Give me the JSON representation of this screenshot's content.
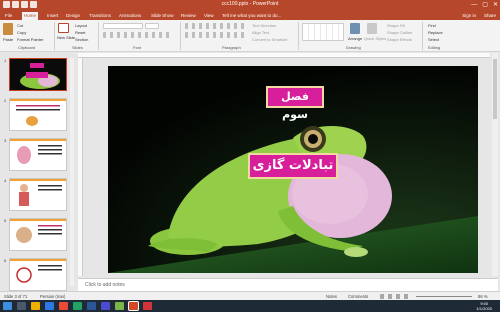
{
  "titlebar": {
    "title": "ccc100.pptx - PowerPoint",
    "min": "—",
    "max": "▢",
    "close": "✕"
  },
  "tabs": [
    "File",
    "Home",
    "Insert",
    "Design",
    "Transitions",
    "Animations",
    "Slide Show",
    "Review",
    "View"
  ],
  "tell_me": "Tell me what you want to do...",
  "sign_in": "Sign in",
  "share": "Share",
  "ribbon": {
    "clipboard": {
      "paste": "Paste",
      "cut": "Cut",
      "copy": "Copy",
      "format_painter": "Format Painter",
      "label": "Clipboard"
    },
    "slides": {
      "new_slide": "New Slide",
      "layout": "Layout",
      "reset": "Reset",
      "section": "Section",
      "label": "Slides"
    },
    "font": {
      "label": "Font"
    },
    "paragraph": {
      "text_direction": "Text Direction",
      "align_text": "Align Text",
      "convert_smartart": "Convert to SmartArt",
      "label": "Paragraph"
    },
    "drawing": {
      "arrange": "Arrange",
      "quick_styles": "Quick Styles",
      "shape_fill": "Shape Fill",
      "shape_outline": "Shape Outline",
      "shape_effects": "Shape Effects",
      "label": "Drawing"
    },
    "editing": {
      "find": "Find",
      "replace": "Replace",
      "select": "Select",
      "label": "Editing"
    }
  },
  "thumbnails": [
    {
      "num": "1"
    },
    {
      "num": "2"
    },
    {
      "num": "3"
    },
    {
      "num": "4"
    },
    {
      "num": "5"
    },
    {
      "num": "6"
    }
  ],
  "slide": {
    "box_top": "فصل سوم",
    "box_main": "تبادلات گازی"
  },
  "notes_placeholder": "Click to add notes",
  "status": {
    "slide_of": "Slide 3 of 71",
    "language": "Persian (Iran)",
    "notes": "Notes",
    "comments": "Comments",
    "zoom": "86 %"
  },
  "clock": {
    "time": "9:00",
    "date": "1/1/2020"
  },
  "colors": {
    "accent": "#b7472a",
    "box_fill": "#d71e9b",
    "box_border": "#f1d9a0"
  }
}
